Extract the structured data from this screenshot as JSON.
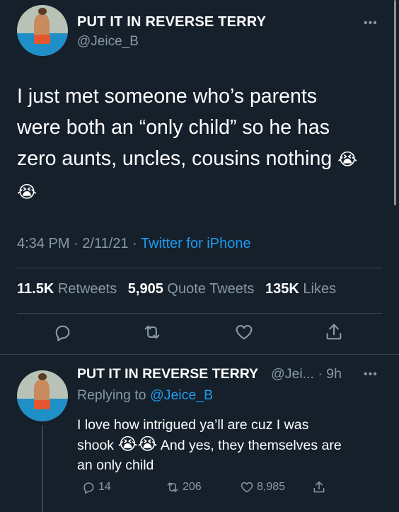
{
  "tweet": {
    "author_name": "PUT IT IN REVERSE TERRY",
    "author_handle": "@Jeice_B",
    "more_label": "•••",
    "text_line_1": "I just met someone who’s parents",
    "text_line_2": "were both an “only child” so he has",
    "text_line_3": "zero aunts, uncles, cousins nothing",
    "emoji": "😭",
    "time": "4:34 PM",
    "date": "2/11/21",
    "sep": " · ",
    "source": "Twitter for iPhone",
    "retweets_count": "11.5K",
    "retweets_label": "Retweets",
    "quote_count": "5,905",
    "quote_label": "Quote Tweets",
    "likes_count": "135K",
    "likes_label": "Likes",
    "actions": [
      "reply-icon",
      "retweet-icon",
      "like-icon",
      "share-icon"
    ]
  },
  "reply": {
    "author_name": "PUT IT IN REVERSE TERRY",
    "handle_time": "@Jei... · 9h",
    "more_label": "•••",
    "replying_prefix": "Replying to ",
    "replying_handle": "@Jeice_B",
    "text_1": "I love how intrigued ya’ll are cuz I was",
    "text_2a": "shook ",
    "emoji": "😭",
    "text_2b": " And yes, they themselves are",
    "text_3": "an only child",
    "reply_count": "14",
    "retweet_count": "206",
    "like_count": "8,985"
  },
  "colors": {
    "background": "#15202b",
    "text": "#ffffff",
    "secondary": "#8899a6",
    "accent": "#1d9bf0",
    "divider": "#38444d"
  }
}
